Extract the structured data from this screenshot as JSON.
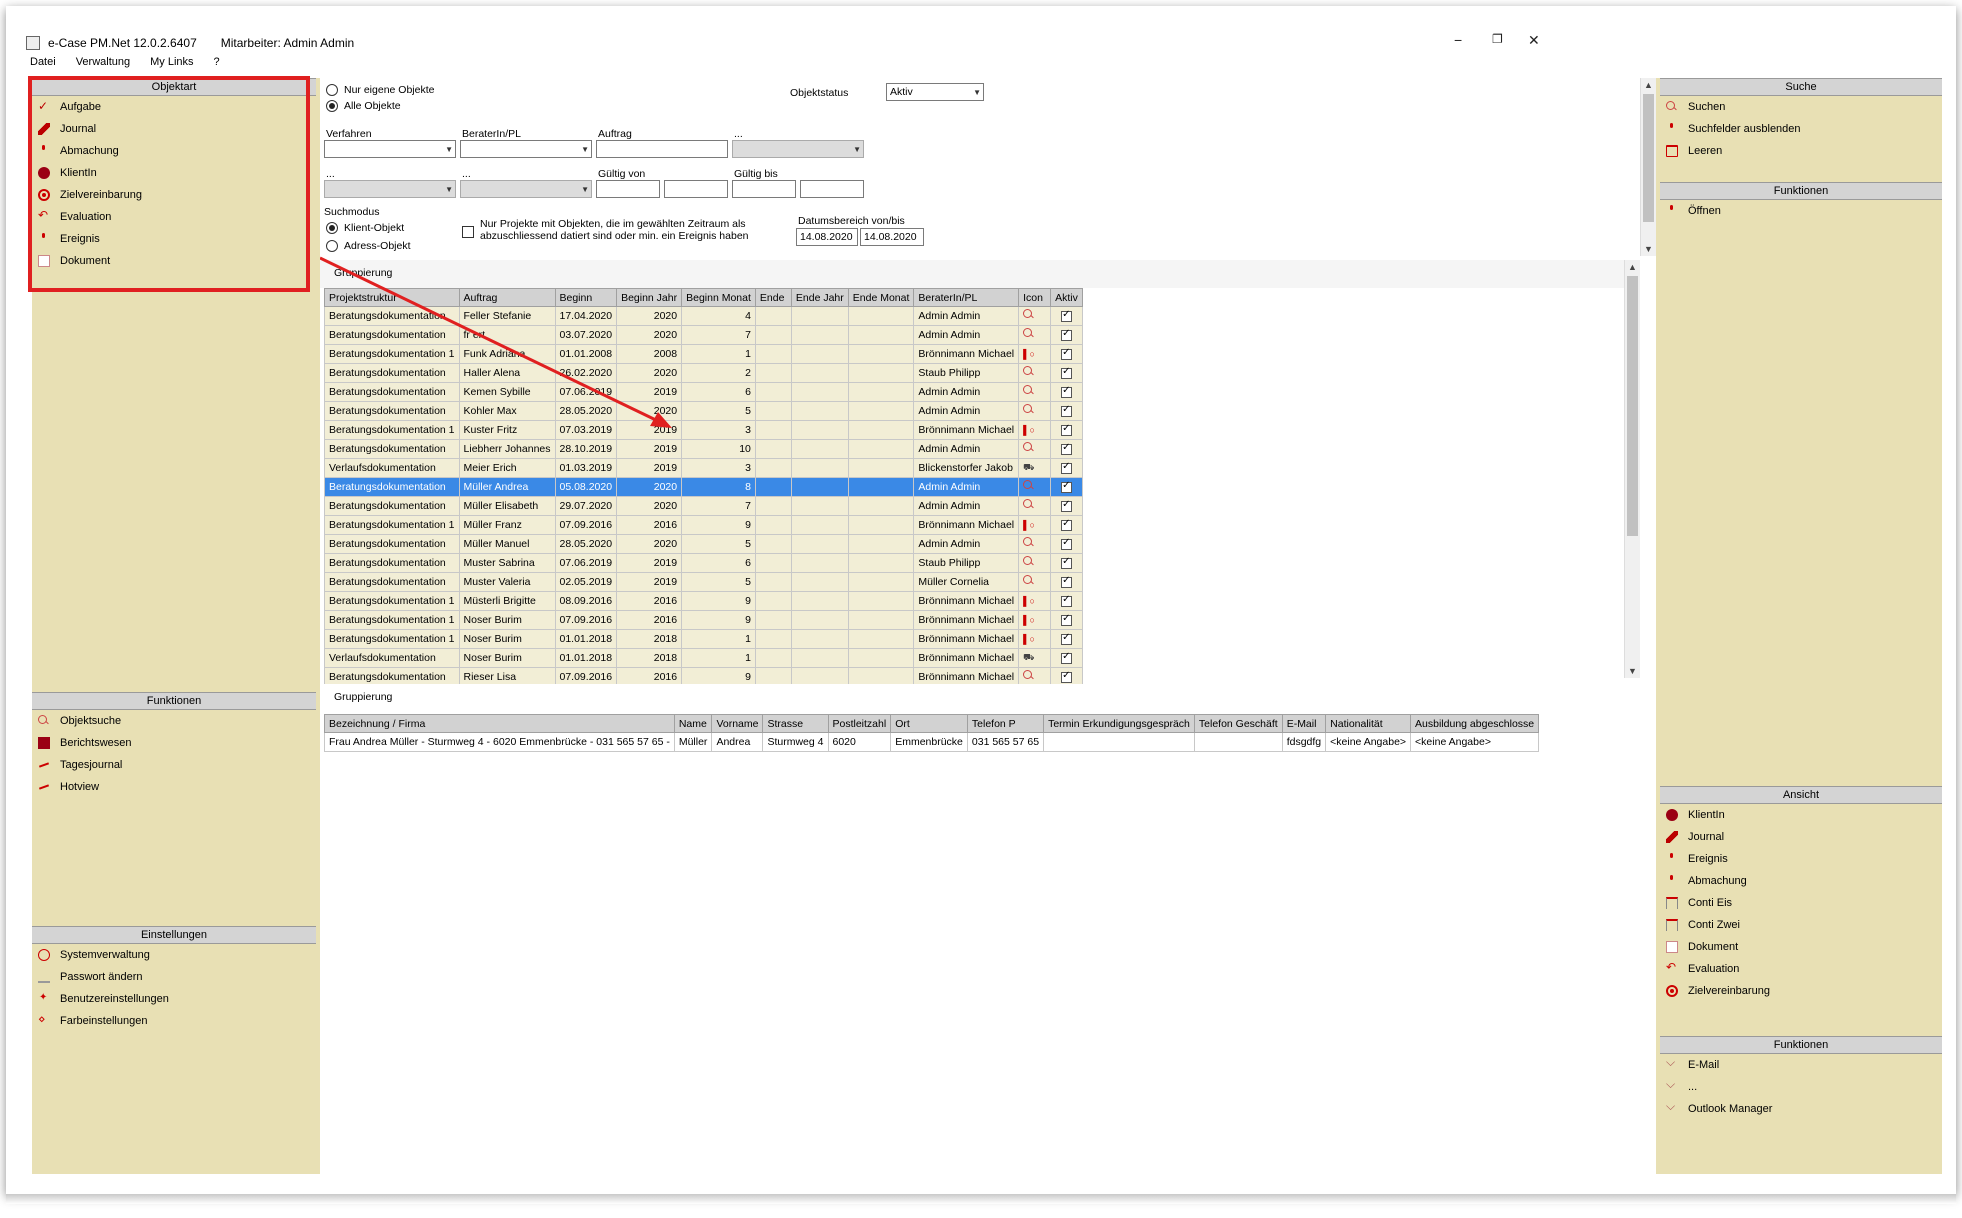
{
  "window": {
    "app_title": "e-Case PM.Net 12.0.2.6407",
    "user_label": "Mitarbeiter: Admin Admin",
    "minimize": "−",
    "restore": "❐",
    "close": "✕"
  },
  "menu": [
    "Datei",
    "Verwaltung",
    "My Links",
    "?"
  ],
  "left": {
    "objektart_title": "Objektart",
    "objektart_items": [
      {
        "label": "Aufgabe",
        "icon": "check-icon"
      },
      {
        "label": "Journal",
        "icon": "pen-icon"
      },
      {
        "label": "Abmachung",
        "icon": "pin-icon"
      },
      {
        "label": "KlientIn",
        "icon": "client-ball-icon"
      },
      {
        "label": "Zielvereinbarung",
        "icon": "target-icon"
      },
      {
        "label": "Evaluation",
        "icon": "undo-arrow-icon"
      },
      {
        "label": "Ereignis",
        "icon": "pin-icon"
      },
      {
        "label": "Dokument",
        "icon": "document-icon"
      }
    ],
    "funktionen_title": "Funktionen",
    "funktionen_items": [
      {
        "label": "Objektsuche",
        "icon": "magnifier-icon"
      },
      {
        "label": "Berichtswesen",
        "icon": "report-icon"
      },
      {
        "label": "Tagesjournal",
        "icon": "pen-line-icon"
      },
      {
        "label": "Hotview",
        "icon": "pen-line-icon"
      }
    ],
    "einstellungen_title": "Einstellungen",
    "einstellungen_items": [
      {
        "label": "Systemverwaltung",
        "icon": "ring-icon"
      },
      {
        "label": "Passwort ändern",
        "icon": "keyboard-icon"
      },
      {
        "label": "Benutzereinstellungen",
        "icon": "star-icon"
      },
      {
        "label": "Farbeinstellungen",
        "icon": "palette-icon"
      }
    ]
  },
  "filters": {
    "radio_own": "Nur eigene Objekte",
    "radio_all": "Alle Objekte",
    "objektstatus_label": "Objektstatus",
    "objektstatus_value": "Aktiv",
    "verfahren_label": "Verfahren",
    "berater_label": "BeraterIn/PL",
    "auftrag_label": "Auftrag",
    "dots_label": "...",
    "gueltig_von_label": "Gültig von",
    "gueltig_bis_label": "Gültig bis",
    "suchmodus_label": "Suchmodus",
    "klient_objekt": "Klient-Objekt",
    "adress_objekt": "Adress-Objekt",
    "nur_projekte_line1": "Nur Projekte mit Objekten, die im gewählten Zeitraum als",
    "nur_projekte_line2": "abzuschliessend datiert sind oder min. ein Ereignis haben",
    "datumsbereich_label": "Datumsbereich von/bis",
    "date_from": "14.08.2020",
    "date_to": "14.08.2020"
  },
  "grid": {
    "gruppierung": "Gruppierung",
    "columns": [
      "Projektstruktur",
      "Auftrag",
      "Beginn",
      "Beginn Jahr",
      "Beginn Monat",
      "Ende",
      "Ende Jahr",
      "Ende Monat",
      "BeraterIn/PL",
      "Icon",
      "Aktiv"
    ],
    "rows": [
      [
        "Beratungsdokumentation",
        "Feller Stefanie",
        "17.04.2020",
        "2020",
        "4",
        "Admin Admin",
        "mag"
      ],
      [
        "Beratungsdokumentation",
        "fr ert",
        "03.07.2020",
        "2020",
        "7",
        "Admin Admin",
        "mag"
      ],
      [
        "Beratungsdokumentation 1",
        "Funk Adriana",
        "01.01.2008",
        "2008",
        "1",
        "Brönnimann Michael",
        "bar"
      ],
      [
        "Beratungsdokumentation",
        "Haller Alena",
        "26.02.2020",
        "2020",
        "2",
        "Staub Philipp",
        "mag"
      ],
      [
        "Beratungsdokumentation",
        "Kemen Sybille",
        "07.06.2019",
        "2019",
        "6",
        "Admin Admin",
        "mag"
      ],
      [
        "Beratungsdokumentation",
        "Kohler Max",
        "28.05.2020",
        "2020",
        "5",
        "Admin Admin",
        "mag"
      ],
      [
        "Beratungsdokumentation 1",
        "Kuster Fritz",
        "07.03.2019",
        "2019",
        "3",
        "Brönnimann Michael",
        "bar"
      ],
      [
        "Beratungsdokumentation",
        "Liebherr Johannes",
        "28.10.2019",
        "2019",
        "10",
        "Admin Admin",
        "mag"
      ],
      [
        "Verlaufsdokumentation",
        "Meier Erich",
        "01.03.2019",
        "2019",
        "3",
        "Blickenstorfer Jakob",
        "car"
      ],
      [
        "Beratungsdokumentation",
        "Müller Andrea",
        "05.08.2020",
        "2020",
        "8",
        "Admin Admin",
        "mag"
      ],
      [
        "Beratungsdokumentation",
        "Müller Elisabeth",
        "29.07.2020",
        "2020",
        "7",
        "Admin Admin",
        "mag"
      ],
      [
        "Beratungsdokumentation 1",
        "Müller Franz",
        "07.09.2016",
        "2016",
        "9",
        "Brönnimann Michael",
        "bar"
      ],
      [
        "Beratungsdokumentation",
        "Müller Manuel",
        "28.05.2020",
        "2020",
        "5",
        "Admin Admin",
        "mag"
      ],
      [
        "Beratungsdokumentation",
        "Muster Sabrina",
        "07.06.2019",
        "2019",
        "6",
        "Staub Philipp",
        "mag"
      ],
      [
        "Beratungsdokumentation",
        "Muster Valeria",
        "02.05.2019",
        "2019",
        "5",
        "Müller Cornelia",
        "mag"
      ],
      [
        "Beratungsdokumentation 1",
        "Müsterli Brigitte",
        "08.09.2016",
        "2016",
        "9",
        "Brönnimann Michael",
        "bar"
      ],
      [
        "Beratungsdokumentation 1",
        "Noser Burim",
        "07.09.2016",
        "2016",
        "9",
        "Brönnimann Michael",
        "bar"
      ],
      [
        "Beratungsdokumentation 1",
        "Noser Burim",
        "01.01.2018",
        "2018",
        "1",
        "Brönnimann Michael",
        "bar"
      ],
      [
        "Verlaufsdokumentation",
        "Noser Burim",
        "01.01.2018",
        "2018",
        "1",
        "Brönnimann Michael",
        "car"
      ],
      [
        "Beratungsdokumentation",
        "Rieser Lisa",
        "07.09.2016",
        "2016",
        "9",
        "Brönnimann Michael",
        "mag"
      ]
    ],
    "selected_row": 9
  },
  "address": {
    "gruppierung": "Gruppierung",
    "columns": [
      "Bezeichnung / Firma",
      "Name",
      "Vorname",
      "Strasse",
      "Postleitzahl",
      "Ort",
      "Telefon P",
      "Termin Erkundigungsgespräch",
      "Telefon Geschäft",
      "E-Mail",
      "Nationalität",
      "Ausbildung abgeschlosse"
    ],
    "rows": [
      [
        "Frau Andrea Müller - Sturmweg 4 - 6020 Emmenbrücke - 031 565 57 65 -",
        "Müller",
        "Andrea",
        "Sturmweg 4",
        "6020",
        "Emmenbrücke",
        "031 565 57 65",
        "",
        "",
        "fdsgdfg",
        "<keine Angabe>",
        "<keine Angabe>"
      ]
    ]
  },
  "right": {
    "suche_title": "Suche",
    "suche_items": [
      {
        "label": "Suchen",
        "icon": "magnifier-icon"
      },
      {
        "label": "Suchfelder ausblenden",
        "icon": "small-square-icon"
      },
      {
        "label": "Leeren",
        "icon": "trash-icon"
      }
    ],
    "funktionen_title": "Funktionen",
    "funktionen_items": [
      {
        "label": "Öffnen",
        "icon": "pin-icon"
      }
    ],
    "ansicht_title": "Ansicht",
    "ansicht_items": [
      {
        "label": "KlientIn",
        "icon": "client-ball-icon"
      },
      {
        "label": "Journal",
        "icon": "pen-icon"
      },
      {
        "label": "Ereignis",
        "icon": "pin-icon"
      },
      {
        "label": "Abmachung",
        "icon": "pin-icon"
      },
      {
        "label": "Conti Eis",
        "icon": "container-icon"
      },
      {
        "label": "Conti Zwei",
        "icon": "container-icon"
      },
      {
        "label": "Dokument",
        "icon": "document-icon"
      },
      {
        "label": "Evaluation",
        "icon": "undo-arrow-icon"
      },
      {
        "label": "Zielvereinbarung",
        "icon": "target-icon"
      }
    ],
    "funktionen2_title": "Funktionen",
    "funktionen2_items": [
      {
        "label": "E-Mail",
        "icon": "chevron-mail-icon"
      },
      {
        "label": "...",
        "icon": "chevron-mail-icon"
      },
      {
        "label": "Outlook Manager",
        "icon": "chevron-mail-icon"
      }
    ]
  },
  "colors": {
    "panel_bg": "#e8e0b4",
    "header_bg": "#d4d4d4",
    "row_bg": "#f2eed6",
    "selected_row": "#3a89e6",
    "highlight_red": "#e02020"
  }
}
